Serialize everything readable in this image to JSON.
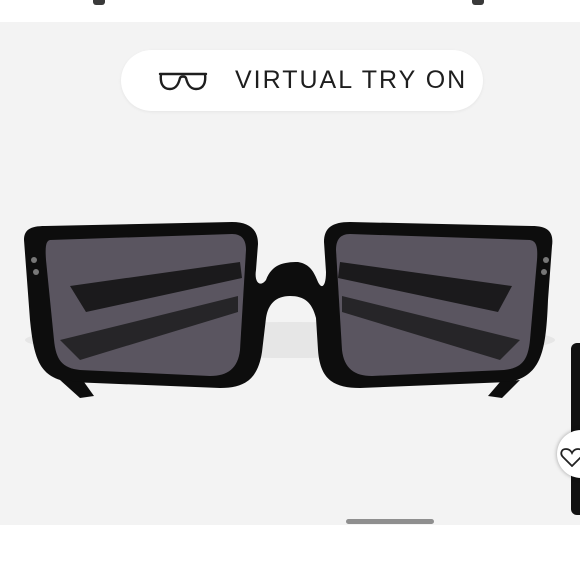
{
  "virtual_try_on": {
    "label": "VIRTUAL TRY ON",
    "icon": "glasses-outline-icon"
  },
  "product_image": {
    "description_icon": "sunglasses-image"
  },
  "side_action": {
    "icon": "heart-icon"
  },
  "colors": {
    "panel_bg": "#f3f3f3",
    "frame": "#0d0d0d",
    "lens": "#5a5560"
  }
}
